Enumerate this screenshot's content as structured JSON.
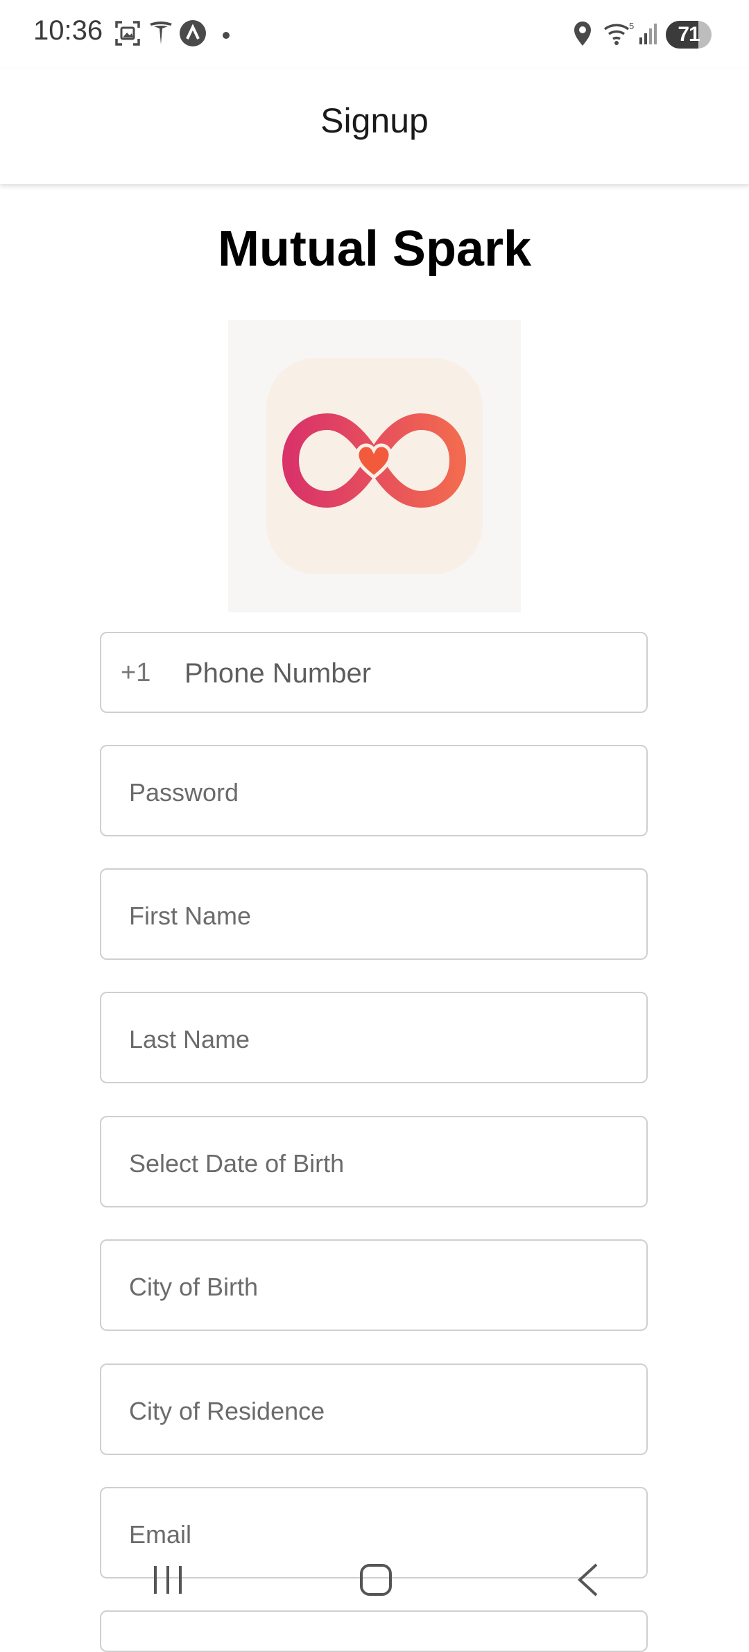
{
  "status_bar": {
    "time": "10:36",
    "battery_level": "71",
    "battery_fraction": 0.71,
    "icons": [
      "screenshot-icon",
      "tesla-icon",
      "app-a-icon",
      "notification-dot-icon",
      "location-icon",
      "wifi-icon",
      "signal-icon",
      "battery-icon"
    ]
  },
  "app_bar": {
    "title": "Signup"
  },
  "brand": {
    "title": "Mutual Spark",
    "logo": "infinity-heart-logo"
  },
  "form": {
    "phone": {
      "prefix": "+1",
      "placeholder": "Phone Number"
    },
    "password": {
      "placeholder": "Password"
    },
    "first_name": {
      "placeholder": "First Name"
    },
    "last_name": {
      "placeholder": "Last Name"
    },
    "dob": {
      "placeholder": "Select Date of Birth"
    },
    "city_birth": {
      "placeholder": "City of Birth"
    },
    "city_residence": {
      "placeholder": "City of Residence"
    },
    "email": {
      "placeholder": "Email"
    }
  },
  "nav_bar": {
    "icons": [
      "recent-apps-icon",
      "home-icon",
      "back-icon"
    ]
  },
  "colors": {
    "logo_gradient_start": "#d9336a",
    "logo_gradient_end": "#f26a4f",
    "heart": "#f25a3c",
    "field_border": "#cfcfcf",
    "placeholder": "#6b6b6b"
  }
}
